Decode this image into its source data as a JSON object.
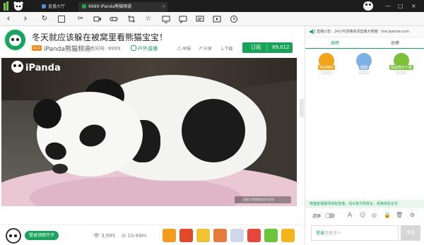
{
  "titlebar": {
    "tabs": [
      {
        "label": "直播大厅"
      },
      {
        "label": "9999 iPanda熊猫频道"
      }
    ],
    "min": "—",
    "max": "□",
    "close": "×"
  },
  "toolbar": {
    "back": "‹",
    "forward": "›",
    "refresh": "↻",
    "cut": "✂",
    "star": "☆"
  },
  "header": {
    "title": "冬天就应该躲在被窝里看熊猫宝宝！",
    "level": "Lv.1",
    "channel_name": "iPanda熊猫频道",
    "room_number": "房间号: 9999",
    "category": "户外直播",
    "report_label": "举报",
    "share_label": "分享",
    "download_label": "下载",
    "subscribe_label": "订阅",
    "subscribe_count": "89,012"
  },
  "video": {
    "watermark": "iPanda",
    "corner_text": "成都大熊猫繁育研究基地"
  },
  "bottom": {
    "bamboo_label": "登录领取竹子",
    "viewers": "3,995",
    "weight": "10.94m"
  },
  "gifts": [
    {
      "name": "gift-1",
      "color": "#f39b1c"
    },
    {
      "name": "gift-2",
      "color": "#e04a2a"
    },
    {
      "name": "gift-3",
      "color": "#f1c232"
    },
    {
      "name": "gift-4",
      "color": "#e67a3c"
    },
    {
      "name": "gift-5",
      "color": "#cfd8e8"
    },
    {
      "name": "gift-6",
      "color": "#e6473a"
    },
    {
      "name": "gift-7",
      "color": "#6cc43a"
    },
    {
      "name": "gift-8",
      "color": "#f5b41c"
    }
  ],
  "right_panel": {
    "announcement": "直播公告：24小时多路高清直播大熊猫：live.ipanda.com",
    "tabs": [
      "周榜",
      "总榜"
    ],
    "ranks": [
      {
        "label": "863神仙",
        "color": "#f2a21b"
      },
      {
        "label": "圆圆",
        "color": "#7fb0e6"
      },
      {
        "label": "我是熊仔小猫",
        "color": "#7bbf3a"
      }
    ],
    "notice": "熊猫直播倡导绿色直播，请大家文明发言，拒绝低俗言论",
    "ctrl_label": "滤屏",
    "input_prefix": "登录",
    "input_rest": "后发言～",
    "send_label": "发送"
  }
}
